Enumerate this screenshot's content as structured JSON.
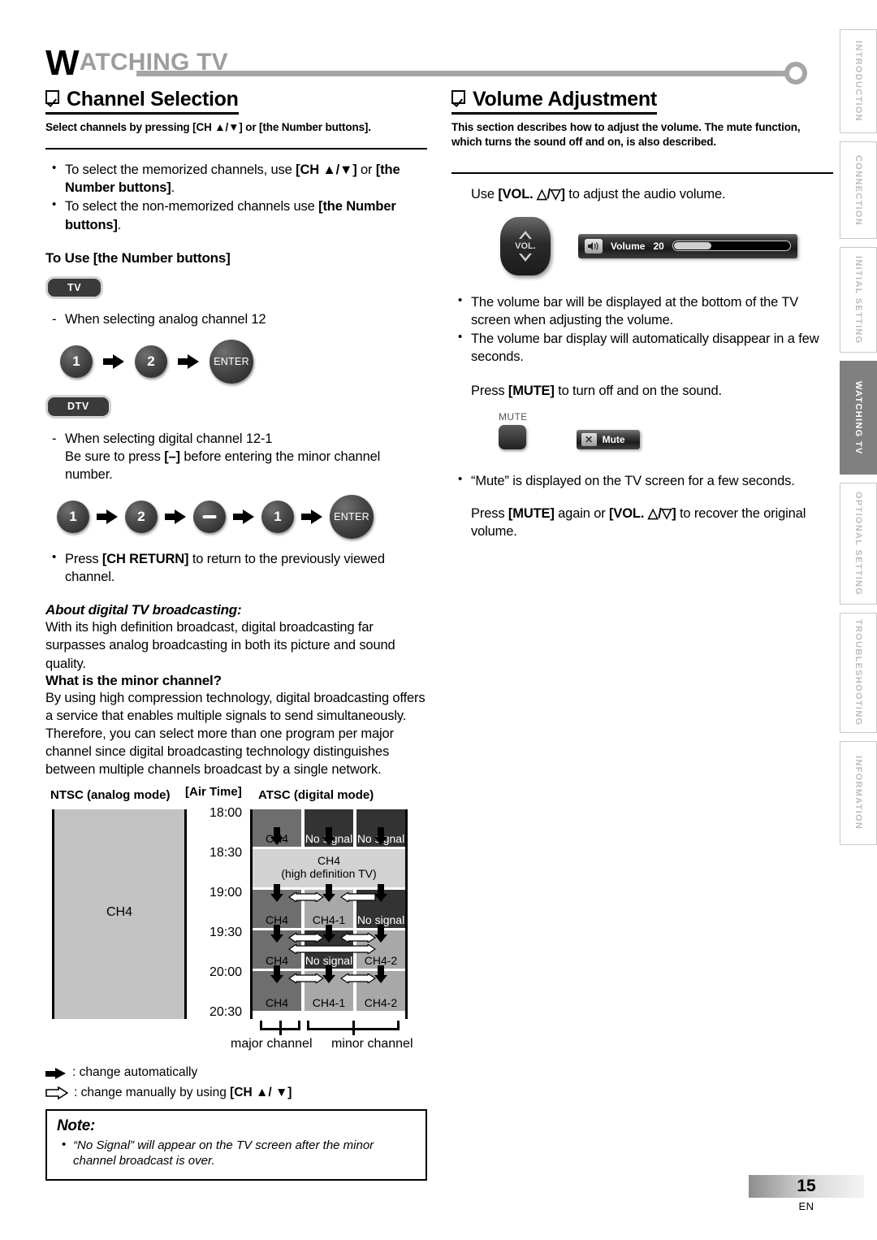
{
  "header": {
    "chapter_cap": "W",
    "chapter_rest": "ATCHING  TV"
  },
  "left": {
    "section_title": "Channel Selection",
    "section_sub": "Select channels by pressing [CH ▲/▼] or [the Number buttons].",
    "bullets": [
      "To select the memorized channels, use [CH ▲/▼] or [the Number buttons].",
      "To select the non-memorized channels use [the Number buttons]."
    ],
    "to_use_heading": "To Use [the Number buttons]",
    "tv_badge": "TV",
    "analog_line": "When selecting analog channel 12",
    "analog_keys": [
      "1",
      "2",
      "ENTER"
    ],
    "dtv_badge": "DTV",
    "digital_line1": "When selecting digital channel 12-1",
    "digital_line2": "Be sure to press [–] before entering the minor channel number.",
    "digital_keys": [
      "1",
      "2",
      "–",
      "1",
      "ENTER"
    ],
    "ch_return_bullet": "Press [CH RETURN] to return to the previously viewed channel.",
    "about_heading": "About digital TV broadcasting:",
    "about_para": "With its high definition broadcast, digital broadcasting far surpasses analog broadcasting in both its picture and sound quality.",
    "minor_heading": "What is the minor channel?",
    "minor_para1": "By using high compression technology, digital broadcasting offers a service that enables multiple signals to send simultaneously.",
    "minor_para2": "Therefore, you can select more than one program per major channel since digital broadcasting technology distinguishes between multiple channels broadcast by a single network.",
    "diagram": {
      "ntsc_header": "NTSC (analog mode)",
      "airtime_header": "[Air Time]",
      "atsc_header": "ATSC (digital mode)",
      "ntsc_channel": "CH4",
      "times": [
        "18:00",
        "18:30",
        "19:00",
        "19:30",
        "20:00",
        "20:30"
      ],
      "cells": {
        "r1_c1": "CH4",
        "r1_c2": "No signal",
        "r1_c3": "No signal",
        "r2_span": "CH4\n(high definition TV)",
        "r2_line1": "CH4",
        "r2_line2": "(high definition TV)",
        "r3_c1": "CH4",
        "r3_c2": "CH4-1",
        "r3_c3": "No signal",
        "r4_c1": "CH4",
        "r4_c2": "No signal",
        "r4_c3": "CH4-2",
        "r5_c1": "CH4",
        "r5_c2": "CH4-1",
        "r5_c3": "CH4-2"
      },
      "major_label": "major channel",
      "minor_label": "minor channel"
    },
    "legend": [
      ": change automatically",
      ": change manually by using [CH ▲/ ▼]"
    ],
    "note_title": "Note:",
    "note_items": [
      "“No Signal” will appear on the TV screen after the minor channel broadcast is over."
    ]
  },
  "right": {
    "section_title": "Volume Adjustment",
    "section_sub": "This section describes how to adjust the volume. The mute function, which turns the sound off and on, is also described.",
    "use_vol_line": "Use [VOL. △/▽] to adjust the audio volume.",
    "vol_rocker_label": "VOL.",
    "osd_volume": {
      "speaker_icon": "speaker-icon",
      "label": "Volume",
      "value": "20",
      "fill_percent": 32
    },
    "bullets": [
      "The volume bar will be displayed at the bottom of the TV screen when adjusting the volume.",
      "The volume bar display will automatically disappear in a few seconds."
    ],
    "mute_press_line": "Press [MUTE] to turn off and on the sound.",
    "mute_button_caption": "MUTE",
    "osd_mute": {
      "icon": "mute-icon",
      "label": "Mute"
    },
    "mute_bullet": "“Mute” is displayed on the TV screen for a few seconds.",
    "mute_recover_line": "Press [MUTE] again or [VOL. △/▽] to recover the original volume."
  },
  "tabs": [
    {
      "label": "INTRODUCTION",
      "active": false
    },
    {
      "label": "CONNECTION",
      "active": false
    },
    {
      "label": "INITIAL  SETTING",
      "active": false
    },
    {
      "label": "WATCHING TV",
      "active": true
    },
    {
      "label": "OPTIONAL  SETTING",
      "active": false
    },
    {
      "label": "TROUBLESHOOTING",
      "active": false
    },
    {
      "label": "INFORMATION",
      "active": false
    }
  ],
  "footer": {
    "page_number": "15",
    "language": "EN"
  },
  "colors": {
    "accent_grey": "#a6a6a6",
    "active_tab": "#808080",
    "ntsc_fill": "#c2c2c2"
  }
}
